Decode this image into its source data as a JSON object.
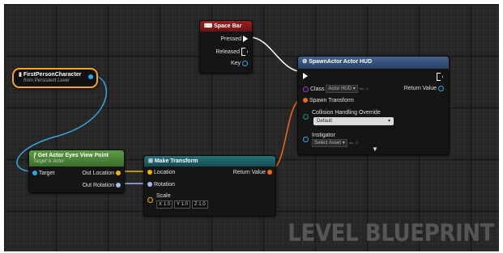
{
  "colors": {
    "event_header": "#8b1a1a",
    "call_header": "#36527a",
    "pure_header": "#4f8a3a",
    "struct_header": "#1f5f64",
    "variable_border": "#f3a42b",
    "object_pin": "#2ca7e6",
    "vector_pin": "#f4b400",
    "rotator_pin": "#a2b9f5",
    "transform_pin": "#f06a16",
    "exec_wire": "#ffffff",
    "object_wire": "#37a7df"
  },
  "watermark": "LEVEL BLUEPRINT",
  "space_bar_node": {
    "icon": "keyboard-icon",
    "title": "Space Bar",
    "pins": {
      "pressed": "Pressed",
      "released": "Released",
      "key": "Key"
    }
  },
  "variable_node": {
    "title": "FirstPersonCharacter",
    "subtitle": "from Persistent Level"
  },
  "eyes_node": {
    "icon": "function-icon",
    "title": "Get Actor Eyes View Point",
    "subtitle": "Target is Actor",
    "pins": {
      "target": "Target",
      "out_location": "Out Location",
      "out_rotation": "Out Rotation"
    }
  },
  "make_transform_node": {
    "icon": "struct-icon",
    "title": "Make Transform",
    "pins": {
      "location": "Location",
      "rotation": "Rotation",
      "scale": "Scale",
      "return_value": "Return Value"
    },
    "scale": {
      "x_label": "X",
      "x": "1.0",
      "y_label": "Y",
      "y": "1.0",
      "z_label": "Z",
      "z": "1.0"
    }
  },
  "spawn_node": {
    "icon": "spawn-icon",
    "title": "SpawnActor Actor HUD",
    "pins": {
      "class": "Class",
      "class_value": "Actor HUD",
      "return_value": "Return Value",
      "spawn_transform": "Spawn Transform",
      "collision": "Collision Handling Override",
      "collision_value": "Default",
      "instigator": "Instigator",
      "instigator_value": "Select Asset"
    }
  }
}
